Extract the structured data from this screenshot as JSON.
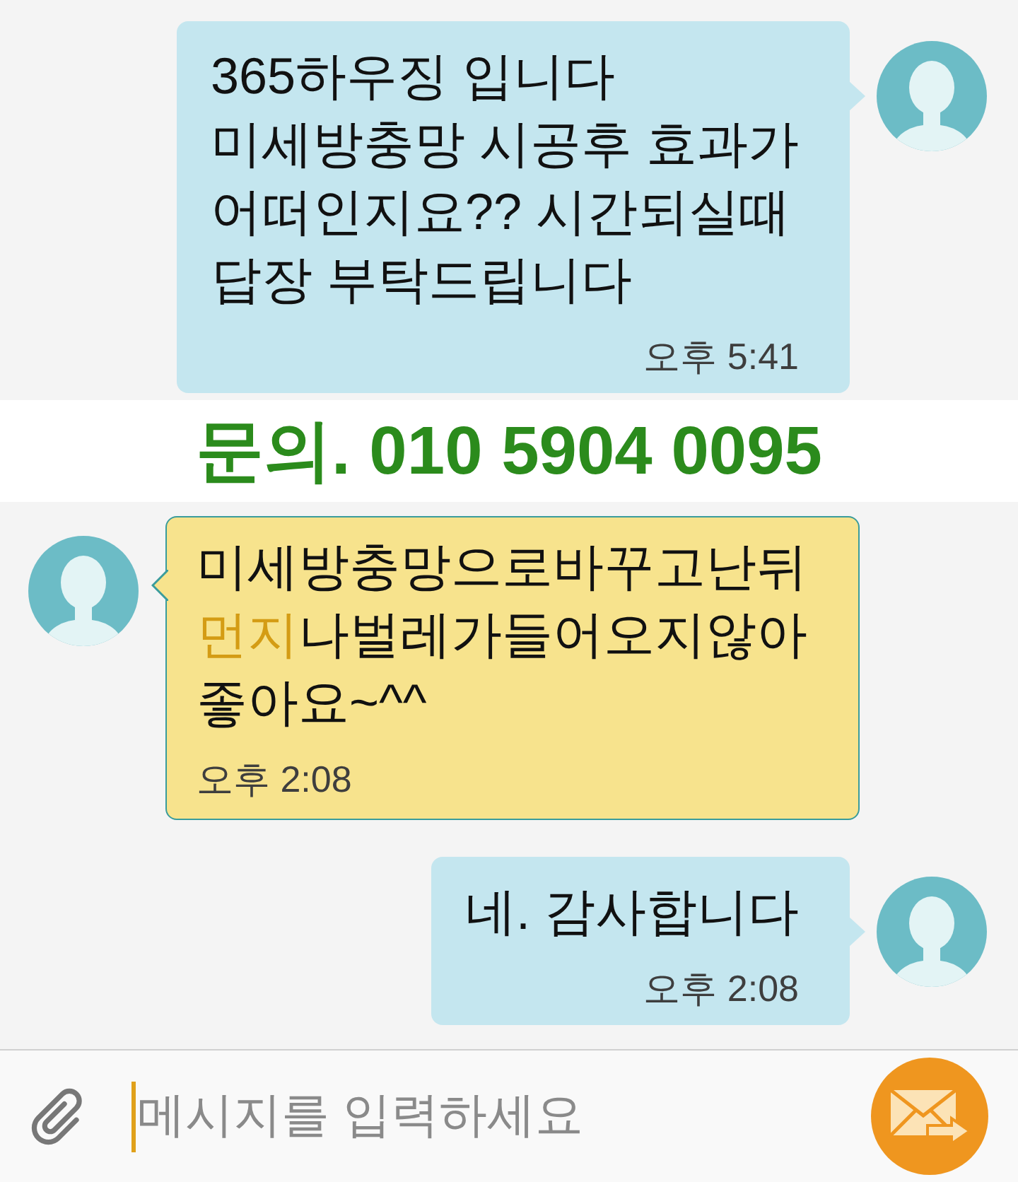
{
  "chat": [
    {
      "kind": "outgoing",
      "runs": [
        {
          "text": "365하우징 입니다\n미세방충망 시공후 효과가\n어떠인지요?? 시간되실때\n답장 부탁드립니다",
          "highlighted": false
        }
      ],
      "time": "오후 5:41"
    },
    {
      "kind": "banner",
      "text": "문의. 010 5904 0095"
    },
    {
      "kind": "incoming",
      "runs": [
        {
          "text": "미세방충망으로바꾸고난뒤\n",
          "highlighted": false
        },
        {
          "text": "먼지",
          "highlighted": true
        },
        {
          "text": "나벌레가들어오지않아\n좋아요~^^",
          "highlighted": false
        }
      ],
      "time": "오후 2:08"
    },
    {
      "kind": "outgoing",
      "runs": [
        {
          "text": "네. 감사합니다",
          "highlighted": false
        }
      ],
      "time": "오후 2:08"
    }
  ],
  "composer": {
    "placeholder": "메시지를 입력하세요",
    "focused": true
  }
}
